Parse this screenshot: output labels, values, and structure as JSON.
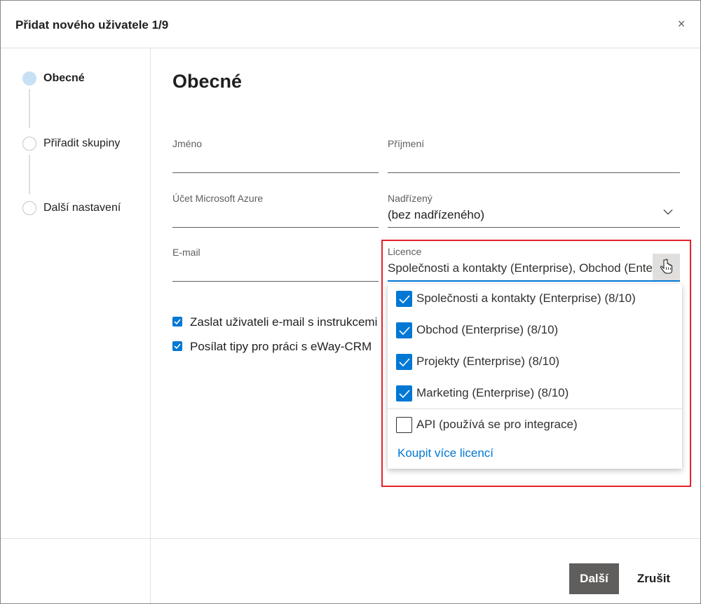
{
  "dialog": {
    "title": "Přidat nového uživatele 1/9",
    "close_label": "×"
  },
  "steps": [
    {
      "label": "Obecné",
      "active": true
    },
    {
      "label": "Přiřadit skupiny",
      "active": false
    },
    {
      "label": "Další nastavení",
      "active": false
    }
  ],
  "main": {
    "heading": "Obecné",
    "fields": {
      "first_name": {
        "label": "Jméno",
        "value": ""
      },
      "last_name": {
        "label": "Příjmení",
        "value": ""
      },
      "azure_account": {
        "label": "Účet Microsoft Azure",
        "value": ""
      },
      "supervisor": {
        "label": "Nadřízený",
        "value": "(bez nadřízeného)"
      },
      "email": {
        "label": "E-mail",
        "value": ""
      },
      "license": {
        "label": "Licence",
        "value": "Společnosti a kontakty (Enterprise), Obchod (Enterprise), Projekty (Enterprise), Marketing (Enterprise)"
      }
    },
    "checkboxes": [
      {
        "label": "Zaslat uživateli e-mail s instrukcemi k",
        "checked": true
      },
      {
        "label": "Posílat tipy pro práci s eWay-CRM",
        "checked": true
      }
    ]
  },
  "license_dropdown": {
    "options": [
      {
        "label": "Společnosti a kontakty (Enterprise) (8/10)",
        "checked": true
      },
      {
        "label": "Obchod (Enterprise) (8/10)",
        "checked": true
      },
      {
        "label": "Projekty (Enterprise) (8/10)",
        "checked": true
      },
      {
        "label": "Marketing (Enterprise) (8/10)",
        "checked": true
      },
      {
        "label": "API (používá se pro integrace)",
        "checked": false
      }
    ],
    "buy_link": "Koupit více licencí"
  },
  "footer": {
    "next_label": "Další",
    "cancel_label": "Zrušit"
  },
  "colors": {
    "accent": "#0078d4",
    "highlight_border": "#e3222b",
    "primary_button": "#605e5c",
    "active_step_dot": "#c7e0f4"
  }
}
